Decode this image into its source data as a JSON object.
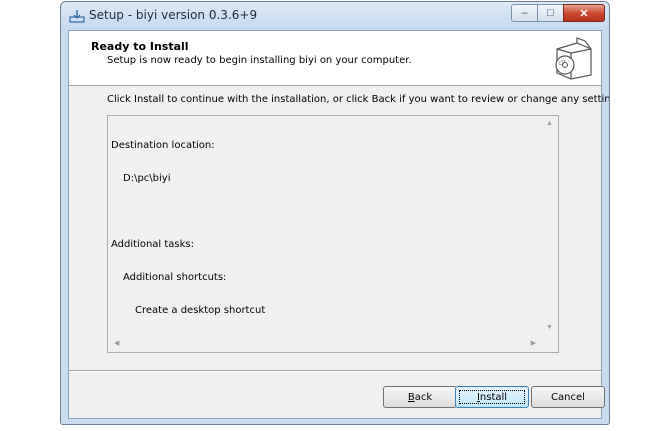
{
  "window": {
    "title": "Setup - biyi version 0.3.6+9",
    "caption_buttons": {
      "minimize": "–",
      "maximize": "□",
      "close": "✕"
    }
  },
  "header": {
    "title": "Ready to Install",
    "subtitle": "Setup is now ready to begin installing biyi on your computer.",
    "image_icon": "setup-box-cd-icon"
  },
  "instruction": "Click Install to continue with the installation, or click Back if you want to review or change any settings.",
  "memo": {
    "destination_label": "Destination location:",
    "destination_value": "D:\\pc\\biyi",
    "tasks_label": "Additional tasks:",
    "shortcuts_label": "Additional shortcuts:",
    "shortcut_item": "Create a desktop shortcut"
  },
  "buttons": {
    "back_prefix": "",
    "back_hotkey": "B",
    "back_rest": "ack",
    "install_hotkey": "I",
    "install_rest": "nstall",
    "cancel": "Cancel"
  }
}
